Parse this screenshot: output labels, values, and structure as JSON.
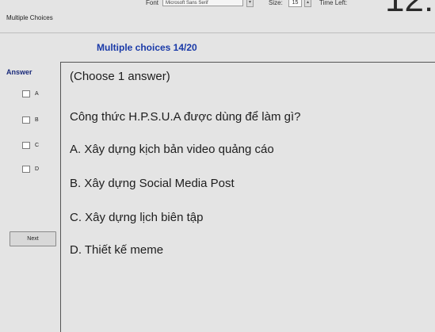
{
  "toolbar": {
    "font_label": "Font",
    "font_value": "Microsoft Sans Serif",
    "size_label": "Size:",
    "size_value": "15",
    "time_label": "Time Left:",
    "time_value": "12:"
  },
  "window": {
    "title": "Multiple Choices"
  },
  "heading": "Multiple choices 14/20",
  "answer_panel": {
    "label": "Answer",
    "options": [
      "A",
      "B",
      "C",
      "D"
    ],
    "next_label": "Next"
  },
  "question": {
    "instruction": "(Choose 1 answer)",
    "text": "Công thức H.P.S.U.A được dùng để làm gì?",
    "choices": [
      "A. Xây dựng kịch bản video quảng cáo",
      "B. Xây dựng Social Media Post",
      "C. Xây dựng lịch biên tập",
      "D. Thiết kế meme"
    ]
  }
}
